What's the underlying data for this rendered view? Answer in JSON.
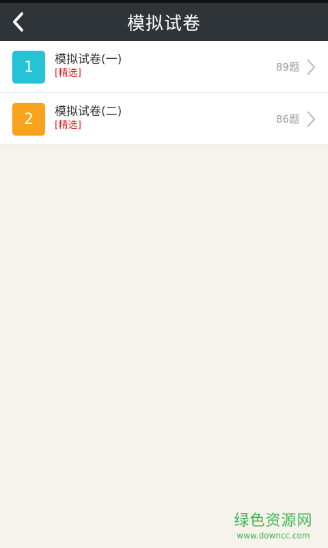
{
  "header": {
    "title": "模拟试卷"
  },
  "papers": [
    {
      "number": "1",
      "name": "模拟试卷(一)",
      "tag": "[精选]",
      "count": "89题",
      "color": "#26c3d6"
    },
    {
      "number": "2",
      "name": "模拟试卷(二)",
      "tag": "[精选]",
      "count": "86题",
      "color": "#f8a31b"
    }
  ],
  "watermark": {
    "title": "绿色资源网",
    "url": "www.downcc.com"
  }
}
